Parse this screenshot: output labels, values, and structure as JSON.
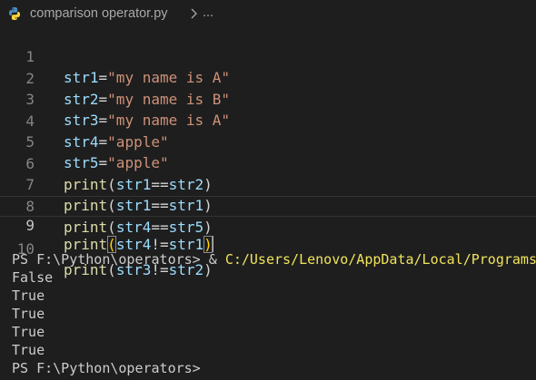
{
  "breadcrumb": {
    "filename": "comparison operator.py",
    "more": "..."
  },
  "editor": {
    "current_line": 9,
    "lines": [
      {
        "num": "1",
        "var": "str1",
        "op": "=",
        "str": "\"my name is A\""
      },
      {
        "num": "2",
        "var": "str2",
        "op": "=",
        "str": "\"my name is B\""
      },
      {
        "num": "3",
        "var": "str3",
        "op": "=",
        "str": "\"my name is A\""
      },
      {
        "num": "4",
        "var": "str4",
        "op": "=",
        "str": "\"apple\""
      },
      {
        "num": "5",
        "var": "str5",
        "op": "=",
        "str": "\"apple\""
      },
      {
        "num": "6",
        "fn": "print",
        "open": "(",
        "a": "str1",
        "op": "==",
        "b": "str2",
        "close": ")"
      },
      {
        "num": "7",
        "fn": "print",
        "open": "(",
        "a": "str1",
        "op": "==",
        "b": "str1",
        "close": ")"
      },
      {
        "num": "8",
        "fn": "print",
        "open": "(",
        "a": "str4",
        "op": "==",
        "b": "str5",
        "close": ")"
      },
      {
        "num": "9",
        "fn": "print",
        "open": "(",
        "a": "str4",
        "op": "!=",
        "b": "str1",
        "close": ")"
      },
      {
        "num": "10",
        "fn": "print",
        "open": "(",
        "a": "str3",
        "op": "!=",
        "b": "str2",
        "close": ")"
      }
    ]
  },
  "terminal": {
    "prompt": "PS F:\\Python\\operators> ",
    "amp": "& ",
    "command_path": "C:/Users/Lenovo/AppData/Local/Programs",
    "outputs": [
      "False",
      "True",
      "True",
      "True",
      "True"
    ],
    "final_prompt": "PS F:\\Python\\operators> "
  },
  "colors": {
    "background": "#1e1e1e",
    "variable": "#9cdcfe",
    "function": "#dcdcaa",
    "string": "#ce9178",
    "bracket": "#ffd700",
    "command_path": "#f0e45c"
  }
}
